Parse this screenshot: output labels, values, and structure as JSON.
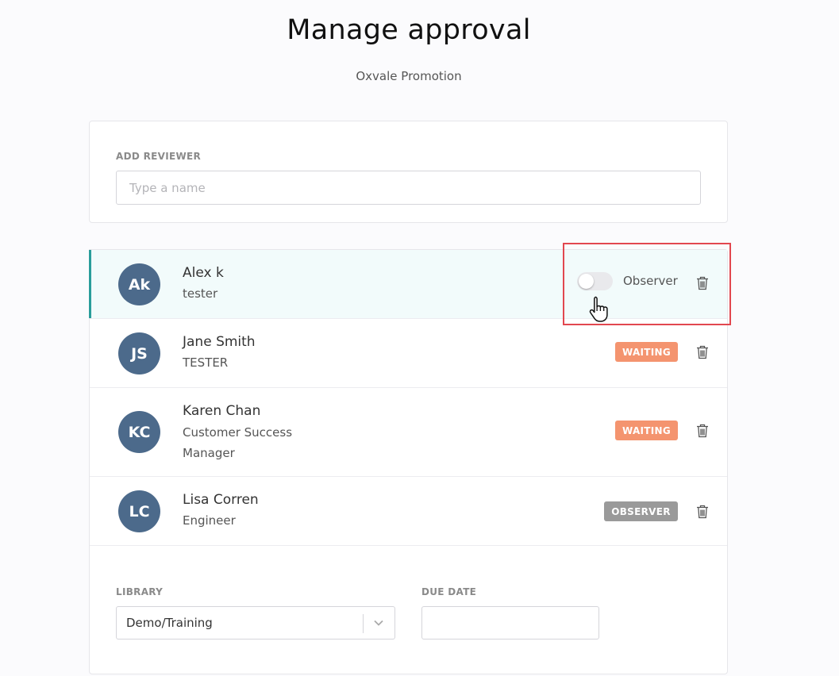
{
  "header": {
    "title": "Manage approval",
    "subtitle": "Oxvale Promotion"
  },
  "add_reviewer": {
    "label": "ADD REVIEWER",
    "placeholder": "Type a name",
    "value": ""
  },
  "reviewers": [
    {
      "initials": "Ak",
      "name": "Alex k",
      "role": "tester",
      "observer_toggle_label": "Observer",
      "observer_toggle_on": false
    },
    {
      "initials": "JS",
      "name": "Jane Smith",
      "role": "TESTER",
      "status": "WAITING"
    },
    {
      "initials": "KC",
      "name": "Karen Chan",
      "role": "Customer Success Manager",
      "status": "WAITING"
    },
    {
      "initials": "LC",
      "name": "Lisa Corren",
      "role": "Engineer",
      "status": "OBSERVER"
    }
  ],
  "library": {
    "label": "LIBRARY",
    "value": "Demo/Training"
  },
  "due_date": {
    "label": "DUE DATE",
    "value": ""
  },
  "colors": {
    "avatar": "#4c6a8b",
    "waiting_badge": "#f4946f",
    "observer_badge": "#9a9a9a",
    "selected_accent": "#2a9d9b",
    "highlight": "#e2474f"
  },
  "icons": [
    "trash-icon",
    "chevron-down-icon",
    "hand-pointer-cursor"
  ]
}
